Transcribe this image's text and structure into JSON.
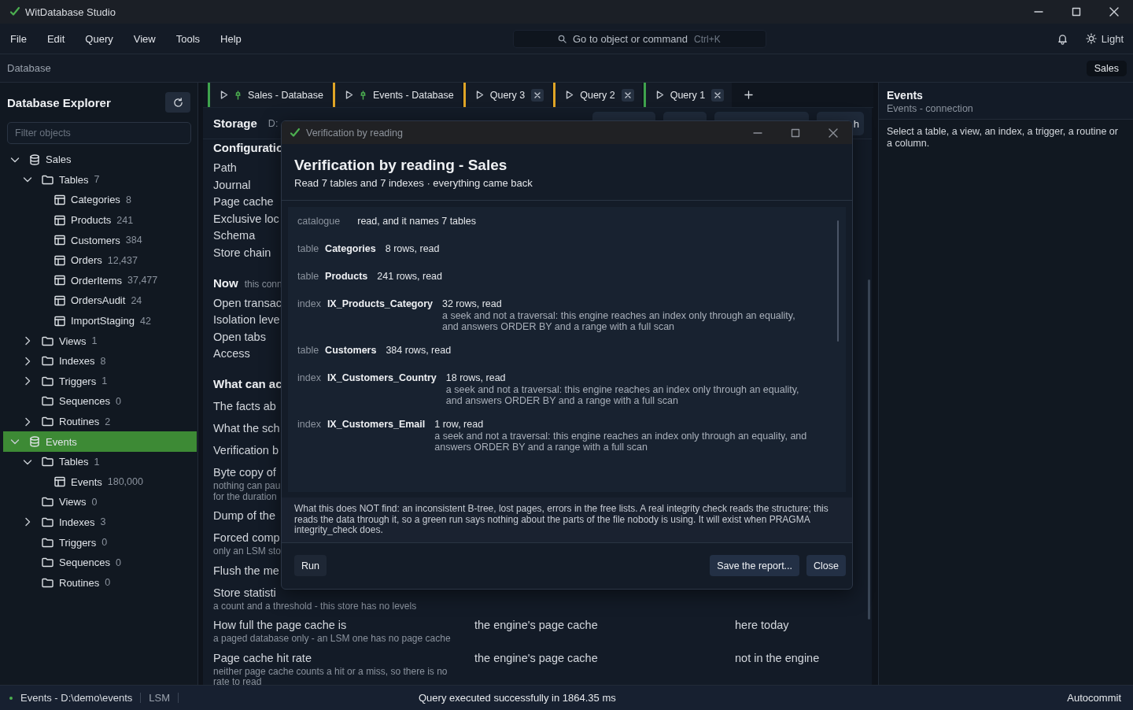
{
  "window": {
    "title": "WitDatabase Studio"
  },
  "menu": [
    "File",
    "Edit",
    "Query",
    "View",
    "Tools",
    "Help"
  ],
  "command_search": {
    "placeholder": "Go to object or command",
    "shortcut": "Ctrl+K"
  },
  "theme_toggle": "Light",
  "breadcrumb": "Database",
  "connection_badge": "Sales",
  "explorer": {
    "title": "Database Explorer",
    "filter": {
      "placeholder": "Filter objects"
    },
    "tree": [
      {
        "label": "Sales",
        "kind": "database",
        "expanded": true,
        "selected": false,
        "children": [
          {
            "label": "Tables",
            "count": "7",
            "kind": "folder",
            "expanded": true,
            "selected": false,
            "children": [
              {
                "label": "Categories",
                "count": "8",
                "kind": "table",
                "selected": false
              },
              {
                "label": "Products",
                "count": "241",
                "kind": "table",
                "selected": false
              },
              {
                "label": "Customers",
                "count": "384",
                "kind": "table",
                "selected": false
              },
              {
                "label": "Orders",
                "count": "12,437",
                "kind": "table",
                "selected": false
              },
              {
                "label": "OrderItems",
                "count": "37,477",
                "kind": "table",
                "selected": false
              },
              {
                "label": "OrdersAudit",
                "count": "24",
                "kind": "table",
                "selected": false
              },
              {
                "label": "ImportStaging",
                "count": "42",
                "kind": "table",
                "selected": false
              }
            ]
          },
          {
            "label": "Views",
            "count": "1",
            "kind": "folder",
            "expanded": false,
            "selected": false
          },
          {
            "label": "Indexes",
            "count": "8",
            "kind": "folder",
            "expanded": false,
            "selected": false
          },
          {
            "label": "Triggers",
            "count": "1",
            "kind": "folder",
            "expanded": false,
            "selected": false
          },
          {
            "label": "Sequences",
            "count": "0",
            "kind": "folder",
            "selected": false
          },
          {
            "label": "Routines",
            "count": "2",
            "kind": "folder",
            "expanded": false,
            "selected": false
          }
        ]
      },
      {
        "label": "Events",
        "kind": "database",
        "expanded": true,
        "selected": true,
        "children": [
          {
            "label": "Tables",
            "count": "1",
            "kind": "folder",
            "expanded": true,
            "selected": false,
            "children": [
              {
                "label": "Events",
                "count": "180,000",
                "kind": "table",
                "selected": false
              }
            ]
          },
          {
            "label": "Views",
            "count": "0",
            "kind": "folder",
            "selected": false
          },
          {
            "label": "Indexes",
            "count": "3",
            "kind": "folder",
            "expanded": false,
            "selected": false
          },
          {
            "label": "Triggers",
            "count": "0",
            "kind": "folder",
            "selected": false
          },
          {
            "label": "Sequences",
            "count": "0",
            "kind": "folder",
            "selected": false
          },
          {
            "label": "Routines",
            "count": "0",
            "kind": "folder",
            "selected": false
          }
        ]
      }
    ]
  },
  "tabs": [
    {
      "label": "Sales - Database",
      "kind": "database",
      "color": "#3fa34d"
    },
    {
      "label": "Events - Database",
      "kind": "database",
      "color": "#e0a526"
    },
    {
      "label": "Query 3",
      "kind": "query",
      "color": "#e0a526"
    },
    {
      "label": "Query 2",
      "kind": "query",
      "color": "#e0a526"
    },
    {
      "label": "Query 1",
      "kind": "query",
      "color": "#3fa34d"
    }
  ],
  "storage": {
    "title": "Storage",
    "path": "D:",
    "toolbar_button": "h",
    "sections": [
      {
        "heading": "Configuratio",
        "rows": [
          {
            "label": "Path"
          },
          {
            "label": "Journal"
          },
          {
            "label": "Page cache"
          },
          {
            "label": "Exclusive loc"
          },
          {
            "label": "Schema"
          },
          {
            "label": "Store chain"
          }
        ]
      },
      {
        "heading": "Now",
        "note": "this conn",
        "rows": [
          {
            "label": "Open transac"
          },
          {
            "label": "Isolation leve"
          },
          {
            "label": "Open tabs"
          },
          {
            "label": "Access"
          }
        ]
      },
      {
        "heading": "What can ac",
        "rows": [
          {
            "label": "The facts ab"
          },
          {
            "label": "What the sch"
          },
          {
            "label": "Verification b"
          },
          {
            "label": "Byte copy of",
            "sub": [
              "nothing can pau",
              "for the duration"
            ]
          },
          {
            "label": "Dump of the"
          },
          {
            "label": "Forced comp",
            "sub": [
              "only an LSM sto"
            ]
          },
          {
            "label": "Flush the me"
          },
          {
            "label": "Store statisti",
            "sub": [
              "a count and a threshold - this store has no levels"
            ]
          },
          {
            "label": "How full the page cache is",
            "sub": [
              "a paged database only - an LSM one has no page cache"
            ],
            "source": "the engine's page cache",
            "availability": "here today"
          },
          {
            "label": "Page cache hit rate",
            "sub": [
              "neither page cache counts a hit or a miss, so there is no rate to read"
            ],
            "source": "the engine's page cache",
            "availability": "not in the engine"
          }
        ]
      }
    ]
  },
  "dialog": {
    "window_title": "Verification by reading",
    "title": "Verification by reading - Sales",
    "summary": "Read 7 tables and 7 indexes · everything came back",
    "results": [
      {
        "object": "catalogue",
        "result": "read, and it names 7 tables"
      },
      {
        "object": "table",
        "name": "Categories",
        "result": "8 rows, read"
      },
      {
        "object": "table",
        "name": "Products",
        "result": "241 rows, read"
      },
      {
        "object": "index",
        "name": "IX_Products_Category",
        "result": "32 rows, read",
        "note": "a seek and not a traversal: this engine reaches an index only through an equality, and answers ORDER BY and a range with a full scan"
      },
      {
        "object": "table",
        "name": "Customers",
        "result": "384 rows, read"
      },
      {
        "object": "index",
        "name": "IX_Customers_Country",
        "result": "18 rows, read",
        "note": "a seek and not a traversal: this engine reaches an index only through an equality, and answers ORDER BY and a range with a full scan"
      },
      {
        "object": "index",
        "name": "IX_Customers_Email",
        "result": "1 row, read",
        "note": "a seek and not a traversal: this engine reaches an index only through an equality, and answers ORDER BY and a range with a full scan"
      }
    ],
    "footnote": "What this does NOT find: an inconsistent B-tree, lost pages, errors in the free lists. A real integrity check reads the structure; this reads the data through it, so a green run says nothing about the parts of the file nobody is using. It will exist when PRAGMA integrity_check does.",
    "run_button": "Run",
    "actions": [
      "Save the report...",
      "Close"
    ]
  },
  "details": {
    "title": "Events",
    "subtitle": "Events - connection",
    "hint": "Select a table, a view, an index, a trigger, a routine or a column."
  },
  "status_bar": {
    "connection": "Events - D:\\demo\\events",
    "engine": "LSM",
    "message": "Query executed successfully in 1864.35 ms",
    "mode": "Autocommit"
  }
}
